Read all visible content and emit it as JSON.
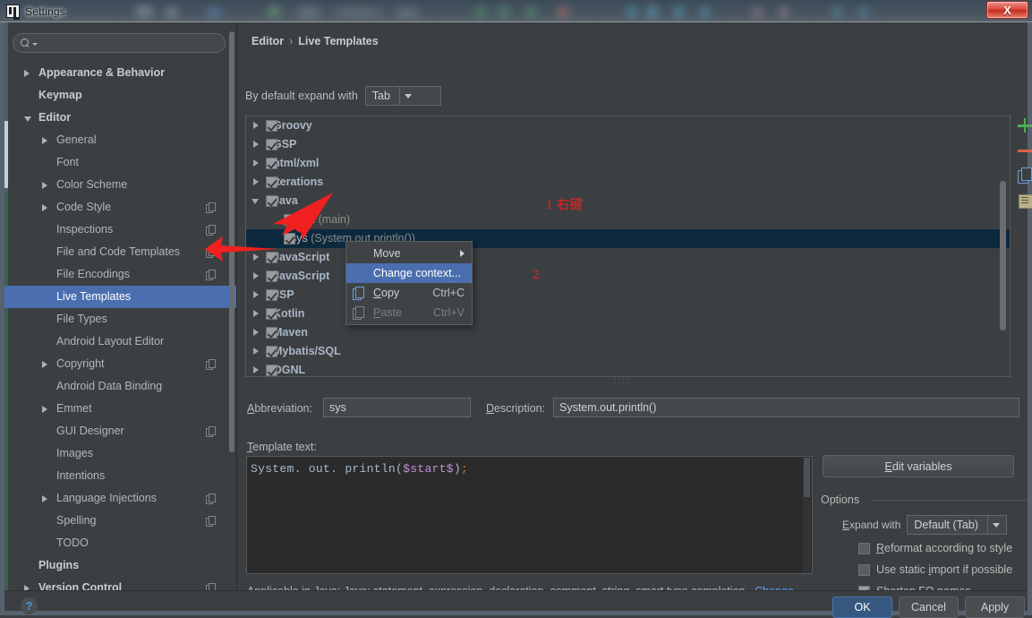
{
  "window": {
    "title": "Settings",
    "close_label": "X",
    "logo_name": "intellij-idea-logo"
  },
  "sidebar": {
    "search": {
      "placeholder": "",
      "value": ""
    },
    "items": [
      {
        "label": "Appearance & Behavior",
        "level": 0,
        "arrow": "right",
        "copy": false,
        "selected": false
      },
      {
        "label": "Keymap",
        "level": 0,
        "arrow": "none",
        "copy": false,
        "selected": false
      },
      {
        "label": "Editor",
        "level": 0,
        "arrow": "down",
        "copy": false,
        "selected": false
      },
      {
        "label": "General",
        "level": 1,
        "arrow": "right",
        "copy": false,
        "selected": false
      },
      {
        "label": "Font",
        "level": 1,
        "arrow": "none",
        "copy": false,
        "selected": false
      },
      {
        "label": "Color Scheme",
        "level": 1,
        "arrow": "right",
        "copy": false,
        "selected": false
      },
      {
        "label": "Code Style",
        "level": 1,
        "arrow": "right",
        "copy": true,
        "selected": false
      },
      {
        "label": "Inspections",
        "level": 1,
        "arrow": "none",
        "copy": true,
        "selected": false
      },
      {
        "label": "File and Code Templates",
        "level": 1,
        "arrow": "none",
        "copy": true,
        "selected": false
      },
      {
        "label": "File Encodings",
        "level": 1,
        "arrow": "none",
        "copy": true,
        "selected": false
      },
      {
        "label": "Live Templates",
        "level": 1,
        "arrow": "none",
        "copy": false,
        "selected": true
      },
      {
        "label": "File Types",
        "level": 1,
        "arrow": "none",
        "copy": false,
        "selected": false
      },
      {
        "label": "Android Layout Editor",
        "level": 1,
        "arrow": "none",
        "copy": false,
        "selected": false
      },
      {
        "label": "Copyright",
        "level": 1,
        "arrow": "right",
        "copy": true,
        "selected": false
      },
      {
        "label": "Android Data Binding",
        "level": 1,
        "arrow": "none",
        "copy": false,
        "selected": false
      },
      {
        "label": "Emmet",
        "level": 1,
        "arrow": "right",
        "copy": false,
        "selected": false
      },
      {
        "label": "GUI Designer",
        "level": 1,
        "arrow": "none",
        "copy": true,
        "selected": false
      },
      {
        "label": "Images",
        "level": 1,
        "arrow": "none",
        "copy": false,
        "selected": false
      },
      {
        "label": "Intentions",
        "level": 1,
        "arrow": "none",
        "copy": false,
        "selected": false
      },
      {
        "label": "Language Injections",
        "level": 1,
        "arrow": "right",
        "copy": true,
        "selected": false
      },
      {
        "label": "Spelling",
        "level": 1,
        "arrow": "none",
        "copy": true,
        "selected": false
      },
      {
        "label": "TODO",
        "level": 1,
        "arrow": "none",
        "copy": false,
        "selected": false
      },
      {
        "label": "Plugins",
        "level": 0,
        "arrow": "none",
        "copy": false,
        "selected": false
      },
      {
        "label": "Version Control",
        "level": 0,
        "arrow": "right",
        "copy": true,
        "selected": false
      }
    ]
  },
  "breadcrumb": {
    "parent": "Editor",
    "separator": "›",
    "current": "Live Templates"
  },
  "expand_with": {
    "label": "By default expand with",
    "value": "Tab"
  },
  "templates_tree": {
    "rows": [
      {
        "label": "Groovy",
        "hint": "",
        "level": "group",
        "arrow": "right",
        "checked": true,
        "selected": false
      },
      {
        "label": "GSP",
        "hint": "",
        "level": "group",
        "arrow": "right",
        "checked": true,
        "selected": false
      },
      {
        "label": "html/xml",
        "hint": "",
        "level": "group",
        "arrow": "right",
        "checked": true,
        "selected": false
      },
      {
        "label": "iterations",
        "hint": "",
        "level": "group",
        "arrow": "right",
        "checked": true,
        "selected": false
      },
      {
        "label": "Java",
        "hint": "",
        "level": "group",
        "arrow": "down",
        "checked": true,
        "selected": false
      },
      {
        "label": "main",
        "hint": "(main)",
        "level": "child",
        "arrow": "none",
        "checked": true,
        "selected": false
      },
      {
        "label": "sys",
        "hint": "(System.out.println())",
        "level": "child",
        "arrow": "none",
        "checked": true,
        "selected": true
      },
      {
        "label": "JavaScript",
        "hint": "",
        "level": "group",
        "arrow": "right",
        "checked": true,
        "selected": false
      },
      {
        "label": "JavaScript",
        "hint": "",
        "level": "group",
        "arrow": "right",
        "checked": true,
        "selected": false
      },
      {
        "label": "JSP",
        "hint": "",
        "level": "group",
        "arrow": "right",
        "checked": true,
        "selected": false
      },
      {
        "label": "Kotlin",
        "hint": "",
        "level": "group",
        "arrow": "right",
        "checked": true,
        "selected": false
      },
      {
        "label": "Maven",
        "hint": "",
        "level": "group",
        "arrow": "right",
        "checked": true,
        "selected": false
      },
      {
        "label": "Mybatis/SQL",
        "hint": "",
        "level": "group",
        "arrow": "right",
        "checked": true,
        "selected": false
      },
      {
        "label": "OGNL",
        "hint": "",
        "level": "group",
        "arrow": "right",
        "checked": true,
        "selected": false
      }
    ],
    "toolbar": [
      {
        "name": "add-template-button",
        "icon": "plus-icon",
        "color": "#4caf50"
      },
      {
        "name": "remove-template-button",
        "icon": "minus-icon",
        "color": "#d9604a"
      },
      {
        "name": "duplicate-template-button",
        "icon": "copy-icon",
        "color": "#6c9fd6"
      },
      {
        "name": "template-group-button",
        "icon": "document-list-icon",
        "color": "#b8b08a"
      }
    ]
  },
  "context_menu": {
    "items": [
      {
        "label": "Move",
        "accel": "",
        "icon": "",
        "submenu": true,
        "highlighted": false,
        "disabled": false
      },
      {
        "label": "Change context...",
        "accel": "",
        "icon": "",
        "submenu": false,
        "highlighted": true,
        "disabled": false
      },
      {
        "label": "Copy",
        "accel": "Ctrl+C",
        "icon": "copy-icon",
        "submenu": false,
        "highlighted": false,
        "disabled": false
      },
      {
        "label": "Paste",
        "accel": "Ctrl+V",
        "icon": "paste-icon",
        "submenu": false,
        "highlighted": false,
        "disabled": true
      }
    ]
  },
  "annotations": [
    {
      "text": "1 右键",
      "name": "annotation-1-right-click"
    },
    {
      "text": "2",
      "name": "annotation-2"
    }
  ],
  "detail": {
    "abbreviation_label": "Abbreviation:",
    "abbreviation_value": "sys",
    "description_label": "Description:",
    "description_value": "System.out.println()",
    "template_text_label": "Template text:",
    "template_code_prefix": "System. out. println(",
    "template_code_variable": "$start$",
    "template_code_close": ")",
    "template_code_semicolon": ";",
    "edit_variables_label": "Edit variables"
  },
  "options": {
    "legend": "Options",
    "expand_with_label": "Expand with",
    "expand_with_value": "Default (Tab)",
    "checkboxes": [
      {
        "label": "Reformat according to style",
        "checked": false
      },
      {
        "label": "Use static import if possible",
        "checked": false
      },
      {
        "label": "Shorten FQ names",
        "checked": true
      }
    ]
  },
  "applicable": {
    "text": "Applicable in Java; Java: statement, expression, declaration, comment, string, smart type completion...",
    "link": "Change"
  },
  "footer": {
    "help_label": "?",
    "ok_label": "OK",
    "cancel_label": "Cancel",
    "apply_label": "Apply"
  },
  "colors": {
    "accent_blue": "#4b6eaf",
    "selection_dark": "#0d293e",
    "panel_bg": "#3c3f41",
    "editor_bg": "#2b2b2b",
    "annotation_red": "#f02020",
    "link_blue": "#589df6"
  }
}
